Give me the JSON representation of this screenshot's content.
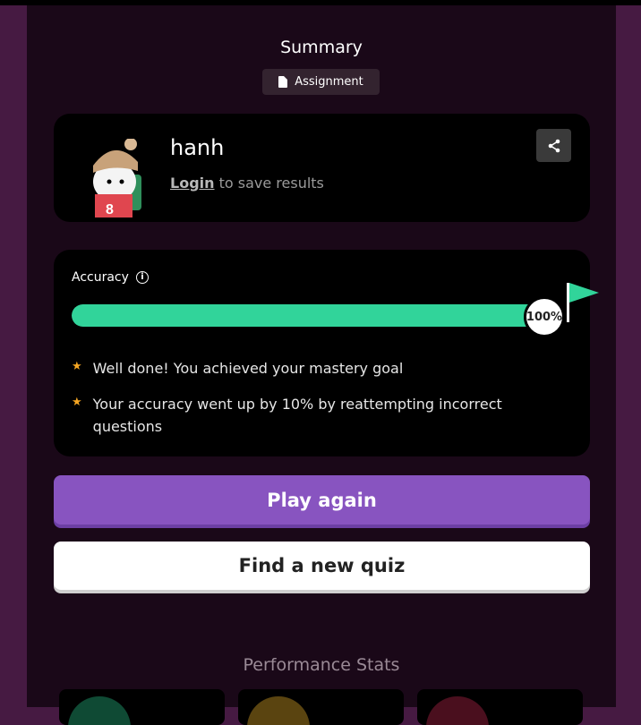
{
  "header": {
    "title": "Summary",
    "badge_label": "Assignment",
    "badge_icon": "document-icon"
  },
  "user": {
    "name": "hanh",
    "login_link": "Login",
    "login_suffix": " to save results",
    "share_icon": "share-icon"
  },
  "accuracy": {
    "label": "Accuracy",
    "percent_text": "100%",
    "percent": 100,
    "bar_color": "#31d49a",
    "points": [
      "Well done! You achieved your mastery goal",
      "Your accuracy went up by 10% by reattempting incorrect questions"
    ]
  },
  "actions": {
    "play_again": "Play again",
    "find_quiz": "Find a new quiz"
  },
  "performance": {
    "title": "Performance Stats"
  },
  "colors": {
    "accent": "#8854c0",
    "panel": "#1a0818",
    "background": "#461a42"
  }
}
